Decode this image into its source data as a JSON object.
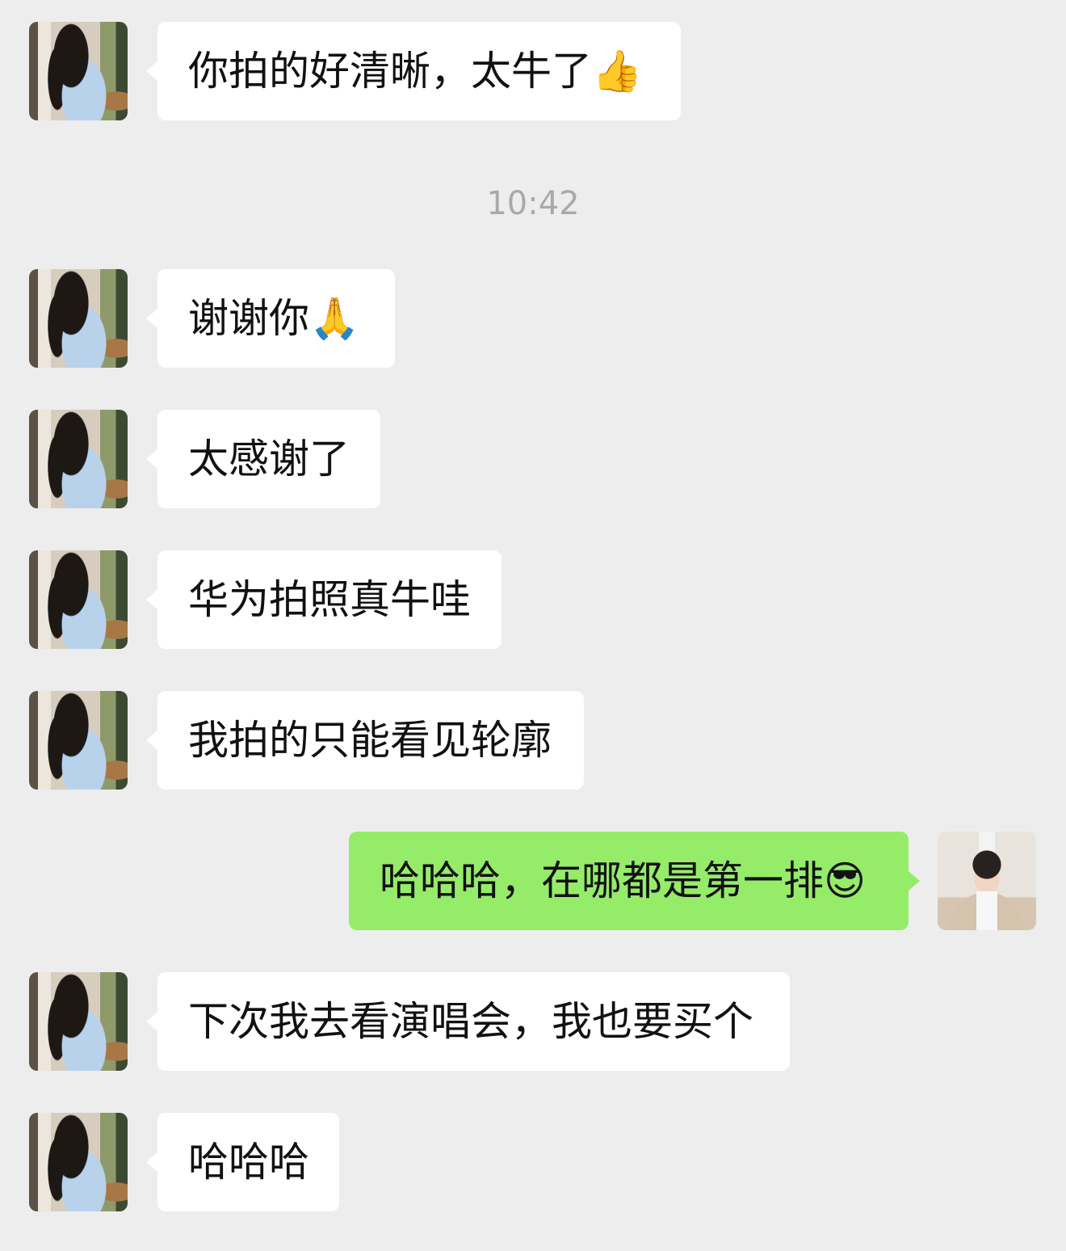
{
  "timestamp": "10:42",
  "messages": [
    {
      "sender": "other",
      "text": "你拍的好清晰，太牛了👍"
    },
    {
      "sender": "other",
      "text": "谢谢你🙏"
    },
    {
      "sender": "other",
      "text": "太感谢了"
    },
    {
      "sender": "other",
      "text": "华为拍照真牛哇"
    },
    {
      "sender": "other",
      "text": "我拍的只能看见轮廓"
    },
    {
      "sender": "self",
      "text": "哈哈哈，在哪都是第一排😎"
    },
    {
      "sender": "other",
      "text": "下次我去看演唱会，我也要买个"
    },
    {
      "sender": "other",
      "text": "哈哈哈"
    }
  ]
}
